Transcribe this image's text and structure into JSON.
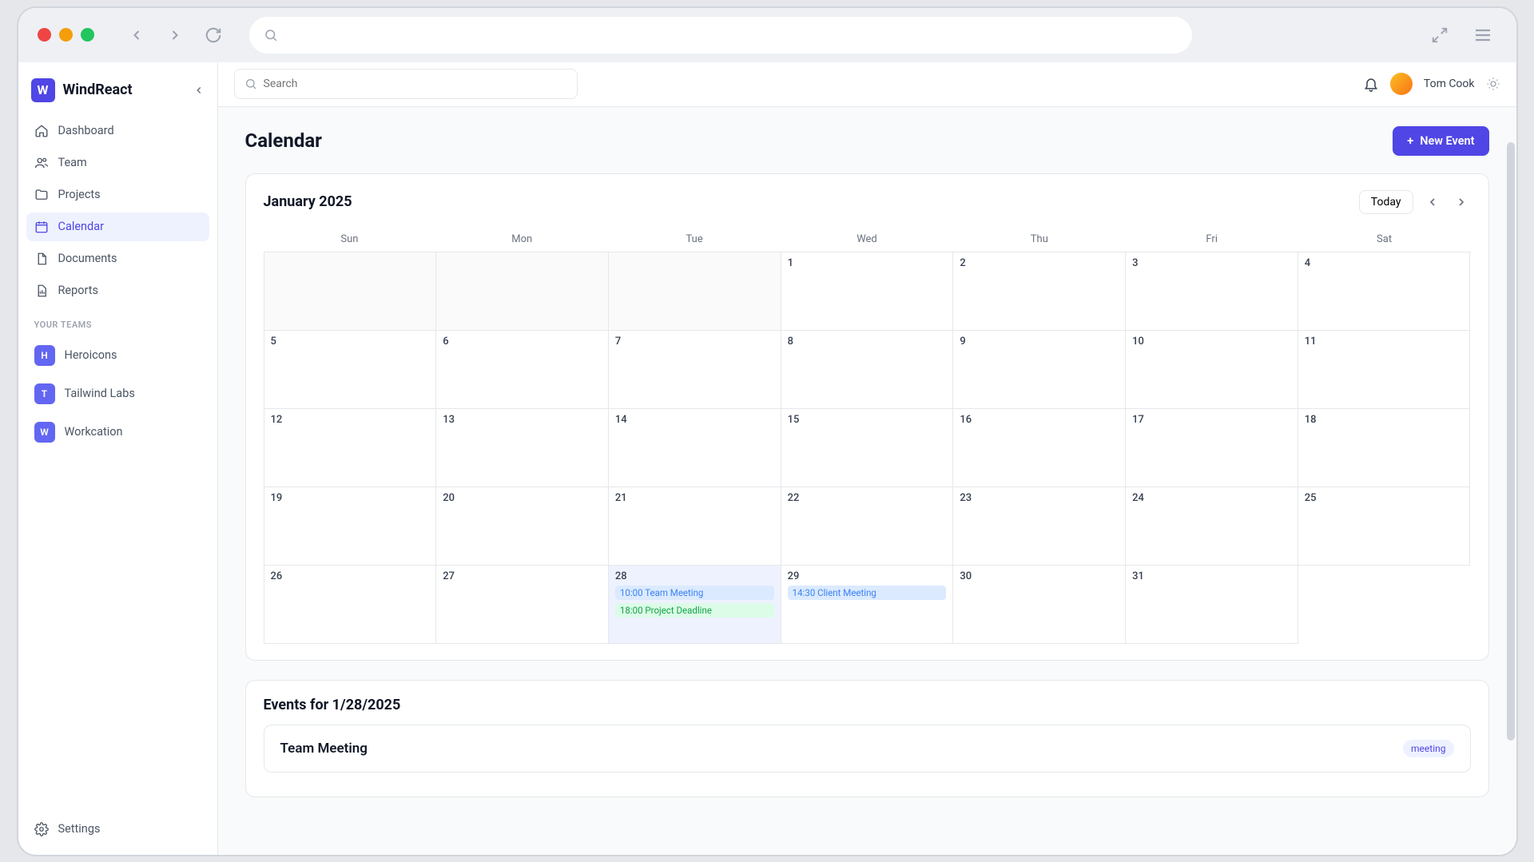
{
  "brand": "WindReact",
  "brand_initial": "W",
  "sidebar": {
    "items": [
      {
        "label": "Dashboard"
      },
      {
        "label": "Team"
      },
      {
        "label": "Projects"
      },
      {
        "label": "Calendar"
      },
      {
        "label": "Documents"
      },
      {
        "label": "Reports"
      }
    ],
    "teams_label": "YOUR TEAMS",
    "teams": [
      {
        "initial": "H",
        "label": "Heroicons"
      },
      {
        "initial": "T",
        "label": "Tailwind Labs"
      },
      {
        "initial": "W",
        "label": "Workcation"
      }
    ],
    "settings_label": "Settings"
  },
  "search_placeholder": "Search",
  "user_name": "Tom Cook",
  "page_title": "Calendar",
  "new_event_label": "New Event",
  "month_label": "January 2025",
  "today_label": "Today",
  "dow": [
    "Sun",
    "Mon",
    "Tue",
    "Wed",
    "Thu",
    "Fri",
    "Sat"
  ],
  "evts": {
    "d28a": "10:00 Team Meeting",
    "d28b": "18:00 Project Deadline",
    "d29a": "14:30 Client Meeting"
  },
  "events_for_label": "Events for 1/28/2025",
  "event_detail_name": "Team Meeting",
  "event_detail_tag": "meeting"
}
